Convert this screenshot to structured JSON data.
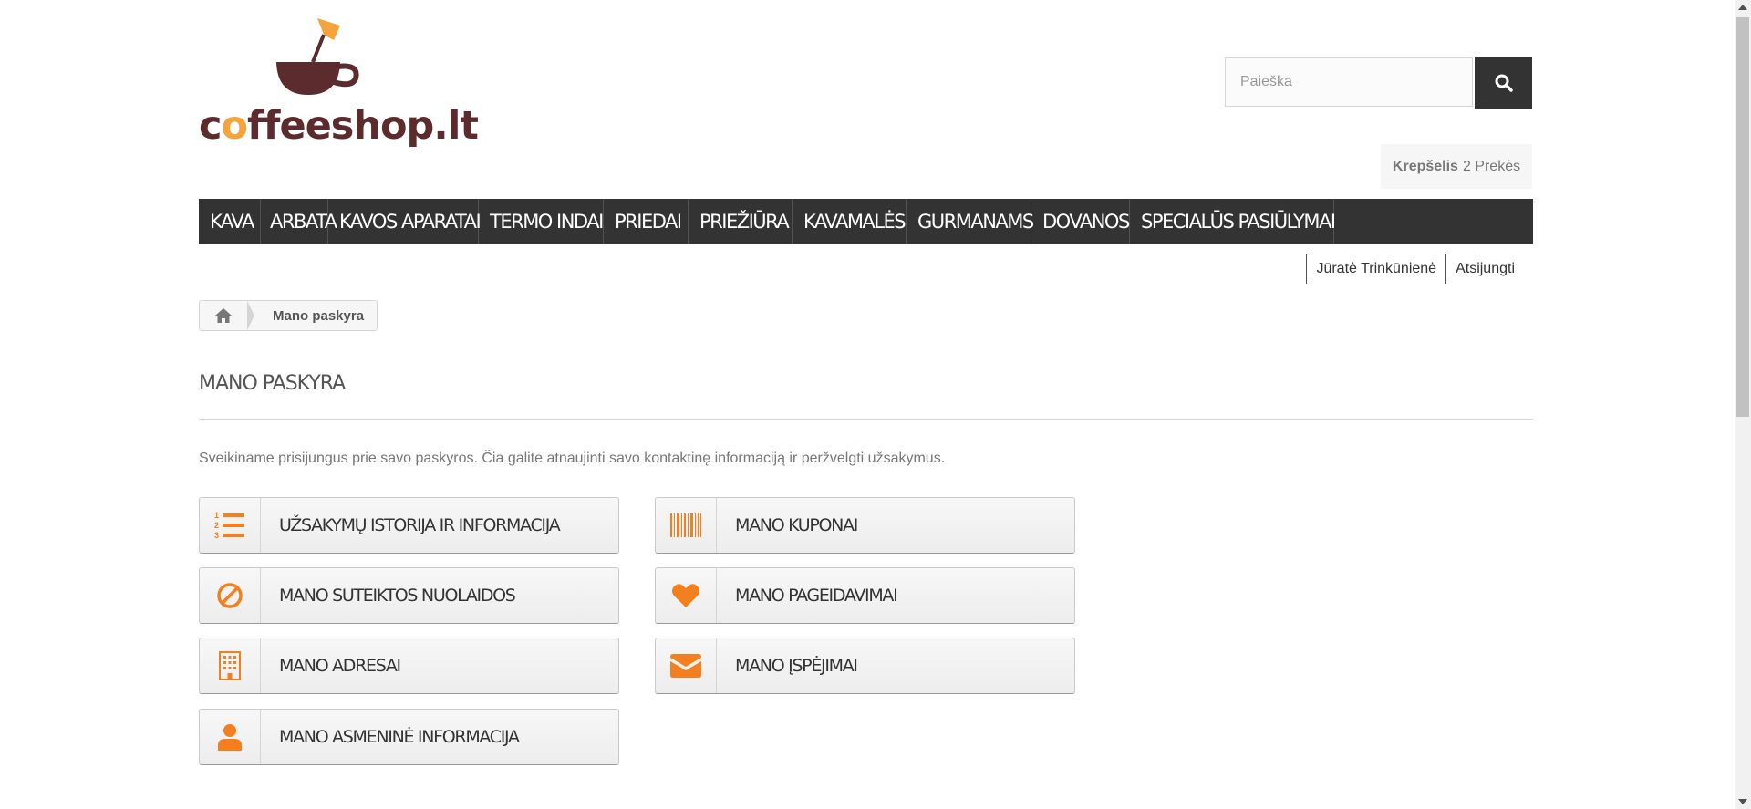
{
  "logo": {
    "text_pre": "c",
    "text_post": "ffeeshop.lt",
    "bean_glyph": "o"
  },
  "search": {
    "placeholder": "Paieška",
    "value": ""
  },
  "cart": {
    "label": "Krepšelis",
    "count_text": "2 Prekės"
  },
  "menu": {
    "items": [
      {
        "label": "KAVA"
      },
      {
        "label": "ARBATA"
      },
      {
        "label": "KAVOS APARATAI"
      },
      {
        "label": "TERMO INDAI"
      },
      {
        "label": "PRIEDAI"
      },
      {
        "label": "PRIEŽIŪRA"
      },
      {
        "label": "KAVAMALĖS"
      },
      {
        "label": "GURMANAMS"
      },
      {
        "label": "DOVANOS"
      },
      {
        "label": "SPECIALŪS PASIŪLYMAI"
      }
    ]
  },
  "user": {
    "name": "Jūratė Trinkūnienė",
    "logout": "Atsijungti"
  },
  "breadcrumb": {
    "home_icon": "home-icon",
    "current": "Mano paskyra"
  },
  "page": {
    "title": "MANO PASKYRA",
    "welcome": "Sveikiname prisijungus prie savo paskyros. Čia galite atnaujinti savo kontaktinę informaciją ir peržvelgti užsakymus."
  },
  "account_links": [
    {
      "label": "UŽSAKYMŲ ISTORIJA IR INFORMACIJA",
      "icon": "list-ol-icon"
    },
    {
      "label": "MANO KUPONAI",
      "icon": "barcode-icon"
    },
    {
      "label": "MANO SUTEIKTOS NUOLAIDOS",
      "icon": "ban-icon"
    },
    {
      "label": "MANO PAGEIDAVIMAI",
      "icon": "heart-icon"
    },
    {
      "label": "MANO ADRESAI",
      "icon": "building-icon"
    },
    {
      "label": "MANO ĮSPĖJIMAI",
      "icon": "envelope-icon"
    },
    {
      "label": "MANO ASMENINĖ INFORMACIJA",
      "icon": "user-icon"
    }
  ],
  "colors": {
    "accent": "#f47f1f",
    "menu_bg": "#333333",
    "logo_brown": "#5b2b2e",
    "logo_orange": "#f6a33b"
  }
}
